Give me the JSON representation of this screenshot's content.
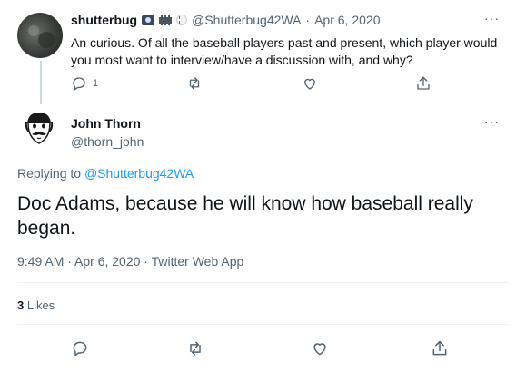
{
  "parent": {
    "name": "shutterbug",
    "handle": "@Shutterbug42WA",
    "sep": "·",
    "date": "Apr 6, 2020",
    "text_line1": "An curious. Of all the baseball players past and present, which player would",
    "text_line2": "you most want to interview/have a discussion with, and why?",
    "reply_count": "1",
    "more": "···"
  },
  "reply": {
    "name": "John Thorn",
    "handle": "@thorn_john",
    "more": "···",
    "replying_to_prefix": "Replying to ",
    "replying_to_handle": "@Shutterbug42WA",
    "text_line1": "Doc Adams, because he will know how baseball really",
    "text_line2": "began.",
    "timestamp": "9:49 AM · Apr 6, 2020 · Twitter Web App",
    "likes_count": "3",
    "likes_label": "Likes"
  },
  "colors": {
    "link": "#1d9bf0",
    "muted": "#536471",
    "divider": "#eff3f4"
  }
}
